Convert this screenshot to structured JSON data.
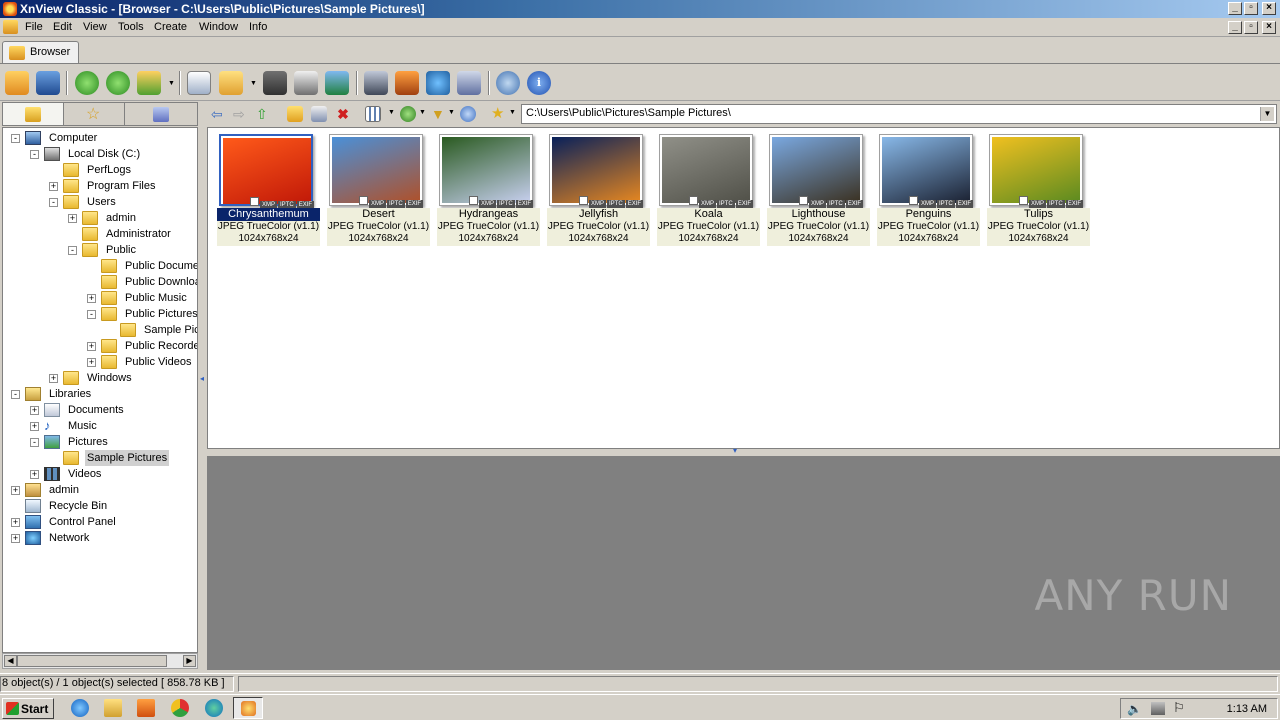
{
  "window": {
    "title": "XnView Classic - [Browser - C:\\Users\\Public\\Pictures\\Sample Pictures\\]"
  },
  "menu": [
    "File",
    "Edit",
    "View",
    "Tools",
    "Create",
    "Window",
    "Info"
  ],
  "tab": {
    "label": "Browser"
  },
  "toolbar": {
    "icons": [
      "open-icon",
      "fullscreen-icon",
      "refresh-icon",
      "refresh-alt-icon",
      "move-up-icon",
      "properties-icon",
      "copy-to-icon",
      "find-icon",
      "print-icon",
      "slideshow-icon",
      "capture-icon",
      "screen-icon",
      "web-icon",
      "contact-sheet-icon",
      "settings-icon",
      "info-icon"
    ]
  },
  "nav": {
    "path": "C:\\Users\\Public\\Pictures\\Sample Pictures\\"
  },
  "tree": [
    {
      "label": "Computer",
      "level": 0,
      "exp": "-",
      "icon": "computer"
    },
    {
      "label": "Local Disk (C:)",
      "level": 1,
      "exp": "-",
      "icon": "drive"
    },
    {
      "label": "PerfLogs",
      "level": 2,
      "exp": "",
      "icon": "folder"
    },
    {
      "label": "Program Files",
      "level": 2,
      "exp": "+",
      "icon": "folder"
    },
    {
      "label": "Users",
      "level": 2,
      "exp": "-",
      "icon": "folder"
    },
    {
      "label": "admin",
      "level": 3,
      "exp": "+",
      "icon": "folder"
    },
    {
      "label": "Administrator",
      "level": 3,
      "exp": "",
      "icon": "folder"
    },
    {
      "label": "Public",
      "level": 3,
      "exp": "-",
      "icon": "folder"
    },
    {
      "label": "Public Documents",
      "level": 4,
      "exp": "",
      "icon": "folder"
    },
    {
      "label": "Public Downloads",
      "level": 4,
      "exp": "",
      "icon": "folder"
    },
    {
      "label": "Public Music",
      "level": 4,
      "exp": "+",
      "icon": "folder"
    },
    {
      "label": "Public Pictures",
      "level": 4,
      "exp": "-",
      "icon": "folder"
    },
    {
      "label": "Sample Pictures",
      "level": 5,
      "exp": "",
      "icon": "folder"
    },
    {
      "label": "Public Recorded TV",
      "level": 4,
      "exp": "+",
      "icon": "folder"
    },
    {
      "label": "Public Videos",
      "level": 4,
      "exp": "+",
      "icon": "folder"
    },
    {
      "label": "Windows",
      "level": 2,
      "exp": "+",
      "icon": "folder"
    },
    {
      "label": "Libraries",
      "level": 0,
      "exp": "-",
      "icon": "library"
    },
    {
      "label": "Documents",
      "level": 1,
      "exp": "+",
      "icon": "documents"
    },
    {
      "label": "Music",
      "level": 1,
      "exp": "+",
      "icon": "music"
    },
    {
      "label": "Pictures",
      "level": 1,
      "exp": "-",
      "icon": "pictures"
    },
    {
      "label": "Sample Pictures",
      "level": 2,
      "exp": "",
      "icon": "folder",
      "selected": true
    },
    {
      "label": "Videos",
      "level": 1,
      "exp": "+",
      "icon": "videos"
    },
    {
      "label": "admin",
      "level": 0,
      "exp": "+",
      "icon": "user"
    },
    {
      "label": "Recycle Bin",
      "level": 0,
      "exp": "",
      "icon": "recycle"
    },
    {
      "label": "Control Panel",
      "level": 0,
      "exp": "+",
      "icon": "control"
    },
    {
      "label": "Network",
      "level": 0,
      "exp": "+",
      "icon": "network"
    }
  ],
  "thumbnails": [
    {
      "name": "Chrysanthemum",
      "info": "JPEG TrueColor (v1.1)",
      "dims": "1024x768x24",
      "selected": true,
      "colors": [
        "#ff5a1a",
        "#c01808"
      ]
    },
    {
      "name": "Desert",
      "info": "JPEG TrueColor (v1.1)",
      "dims": "1024x768x24",
      "colors": [
        "#4a90d8",
        "#b05028"
      ]
    },
    {
      "name": "Hydrangeas",
      "info": "JPEG TrueColor (v1.1)",
      "dims": "1024x768x24",
      "colors": [
        "#2a5a20",
        "#c8d0f0"
      ]
    },
    {
      "name": "Jellyfish",
      "info": "JPEG TrueColor (v1.1)",
      "dims": "1024x768x24",
      "colors": [
        "#08205a",
        "#e88820"
      ]
    },
    {
      "name": "Koala",
      "info": "JPEG TrueColor (v1.1)",
      "dims": "1024x768x24",
      "colors": [
        "#909088",
        "#505048"
      ]
    },
    {
      "name": "Lighthouse",
      "info": "JPEG TrueColor (v1.1)",
      "dims": "1024x768x24",
      "colors": [
        "#7aa8e0",
        "#3a3020"
      ]
    },
    {
      "name": "Penguins",
      "info": "JPEG TrueColor (v1.1)",
      "dims": "1024x768x24",
      "colors": [
        "#88b8e8",
        "#1a2030"
      ]
    },
    {
      "name": "Tulips",
      "info": "JPEG TrueColor (v1.1)",
      "dims": "1024x768x24",
      "colors": [
        "#f0c020",
        "#5a8a20"
      ]
    }
  ],
  "badges": [
    "XMP",
    "IPTC",
    "EXIF"
  ],
  "status": {
    "text": "8 object(s) / 1 object(s) selected  [ 858.78 KB ]"
  },
  "taskbar": {
    "start": "Start",
    "clock": "1:13 AM"
  },
  "watermark": "ANY RUN"
}
